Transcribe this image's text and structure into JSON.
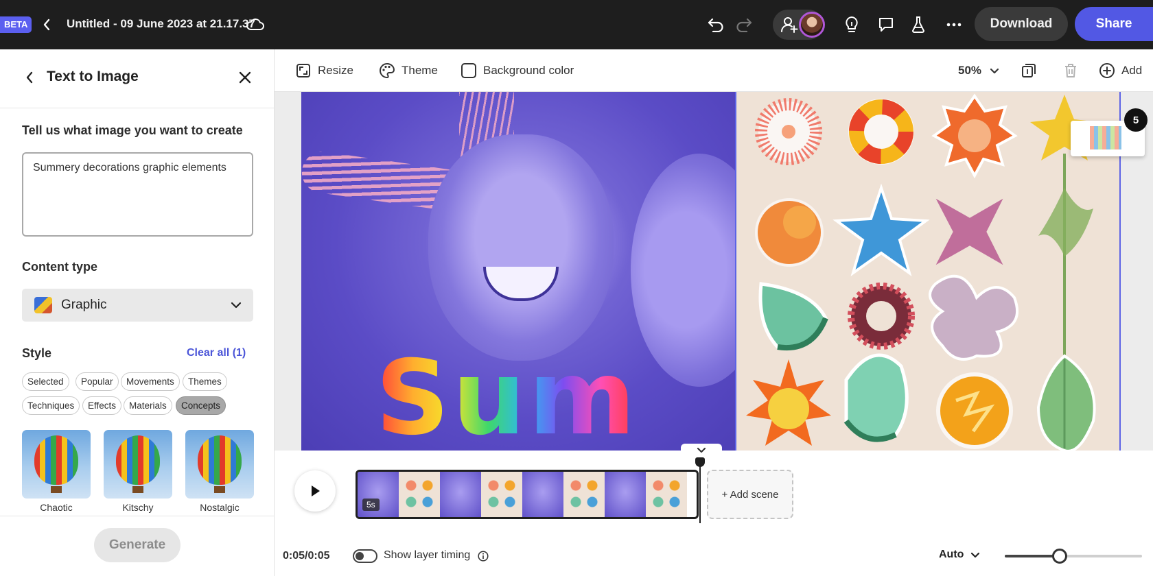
{
  "topbar": {
    "beta": "BETA",
    "title": "Untitled - 09 June 2023 at 21.17.37",
    "download_label": "Download",
    "share_label": "Share"
  },
  "panel": {
    "title": "Text to Image",
    "prompt_label": "Tell us what image you want to create",
    "prompt_value": "Summery decorations graphic elements",
    "content_type_label": "Content type",
    "content_type_value": "Graphic",
    "style_label": "Style",
    "clear_all": "Clear all (1)",
    "chips": [
      {
        "label": "Selected",
        "active": false
      },
      {
        "label": "Popular",
        "active": false
      },
      {
        "label": "Movements",
        "active": false
      },
      {
        "label": "Themes",
        "active": false
      },
      {
        "label": "Techniques",
        "active": false
      },
      {
        "label": "Effects",
        "active": false
      },
      {
        "label": "Materials",
        "active": false
      },
      {
        "label": "Concepts",
        "active": true
      }
    ],
    "styles": [
      "Chaotic",
      "Kitschy",
      "Nostalgic"
    ],
    "generate_label": "Generate"
  },
  "canvas_toolbar": {
    "resize": "Resize",
    "theme": "Theme",
    "background_color": "Background color",
    "zoom": "50%",
    "add": "Add"
  },
  "canvas": {
    "headline": "Sum",
    "page_count": "5"
  },
  "timeline": {
    "scene_duration": "5s",
    "add_scene": "+ Add scene",
    "time": "0:05/0:05",
    "show_layer_timing": "Show layer timing",
    "auto": "Auto",
    "zoom_level": 0.4
  }
}
